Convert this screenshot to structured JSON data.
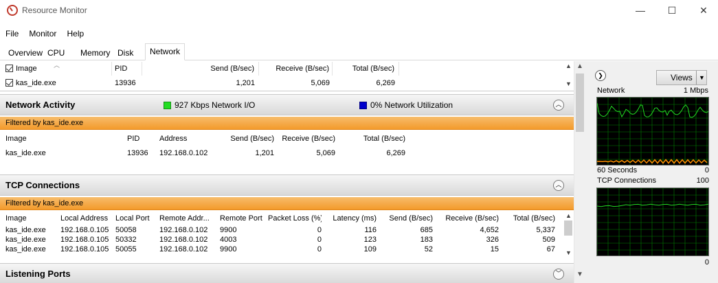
{
  "window": {
    "title": "Resource Monitor",
    "minimize": "—",
    "maximize": "☐",
    "close": "✕"
  },
  "menu": [
    "File",
    "Monitor",
    "Help"
  ],
  "tabs": [
    {
      "label": "Overview",
      "active": false
    },
    {
      "label": "CPU",
      "active": false
    },
    {
      "label": "Memory",
      "active": false
    },
    {
      "label": "Disk",
      "active": false
    },
    {
      "label": "Network",
      "active": true
    }
  ],
  "processes": {
    "headers": {
      "image": "Image",
      "pid": "PID",
      "send": "Send (B/sec)",
      "receive": "Receive (B/sec)",
      "total": "Total (B/sec)"
    },
    "rows": [
      {
        "image": "kas_ide.exe",
        "pid": "13936",
        "send": "1,201",
        "receive": "5,069",
        "total": "6,269"
      }
    ]
  },
  "network_activity": {
    "title": "Network Activity",
    "io_label": "927 Kbps Network I/O",
    "util_label": "0% Network Utilization",
    "io_color": "#22dd22",
    "util_color": "#0000cc",
    "filter": "Filtered by kas_ide.exe",
    "headers": {
      "image": "Image",
      "pid": "PID",
      "address": "Address",
      "send": "Send (B/sec)",
      "receive": "Receive (B/sec)",
      "total": "Total (B/sec)"
    },
    "rows": [
      {
        "image": "kas_ide.exe",
        "pid": "13936",
        "address": "192.168.0.102",
        "send": "1,201",
        "receive": "5,069",
        "total": "6,269"
      }
    ]
  },
  "tcp": {
    "title": "TCP Connections",
    "filter": "Filtered by kas_ide.exe",
    "headers": {
      "image": "Image",
      "local_address": "Local Address",
      "local_port": "Local Port",
      "remote_address": "Remote Addr...",
      "remote_port": "Remote Port",
      "packet_loss": "Packet Loss (%)",
      "latency": "Latency (ms)",
      "send": "Send (B/sec)",
      "receive": "Receive (B/sec)",
      "total": "Total (B/sec)"
    },
    "rows": [
      {
        "image": "kas_ide.exe",
        "local_address": "192.168.0.105",
        "local_port": "50058",
        "remote_address": "192.168.0.102",
        "remote_port": "9900",
        "packet_loss": "0",
        "latency": "116",
        "send": "685",
        "receive": "4,652",
        "total": "5,337"
      },
      {
        "image": "kas_ide.exe",
        "local_address": "192.168.0.105",
        "local_port": "50332",
        "remote_address": "192.168.0.102",
        "remote_port": "4003",
        "packet_loss": "0",
        "latency": "123",
        "send": "183",
        "receive": "326",
        "total": "509"
      },
      {
        "image": "kas_ide.exe",
        "local_address": "192.168.0.105",
        "local_port": "50055",
        "remote_address": "192.168.0.102",
        "remote_port": "9900",
        "packet_loss": "0",
        "latency": "109",
        "send": "52",
        "receive": "15",
        "total": "67"
      }
    ]
  },
  "listening": {
    "title": "Listening Ports"
  },
  "side": {
    "views_label": "Views",
    "network_title": "Network",
    "network_scale": "1 Mbps",
    "seconds_label": "60 Seconds",
    "zero_label": "0",
    "tcp_title": "TCP Connections",
    "tcp_scale": "100",
    "tcp_zero": "0",
    "graph_line_color": "#22dd22",
    "graph_secondary_color": "#ff8c00",
    "graph_grid_color": "#008000"
  }
}
